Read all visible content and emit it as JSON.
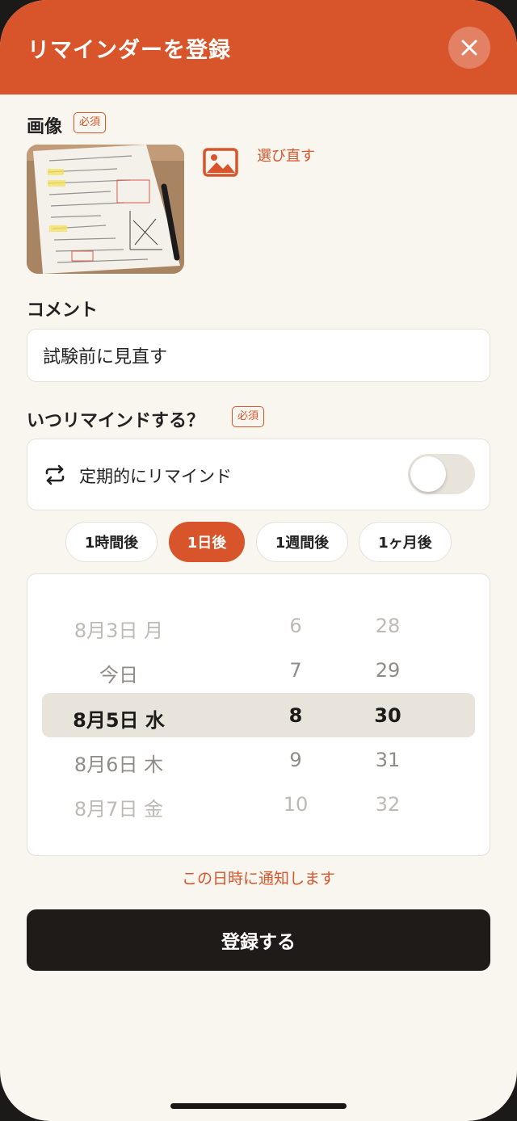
{
  "header": {
    "title": "リマインダーを登録"
  },
  "image_section": {
    "label": "画像",
    "required_badge": "必須",
    "reselect_label": "選び直す"
  },
  "comment_section": {
    "label": "コメント",
    "value": "試験前に見直す"
  },
  "when_section": {
    "label": "いつリマインドする？",
    "required_badge": "必須",
    "recurring_label": "定期的にリマインド",
    "recurring_enabled": false
  },
  "quick_options": {
    "items": [
      "1時間後",
      "1日後",
      "1週間後",
      "1ヶ月後"
    ],
    "selected": "1日後"
  },
  "picker": {
    "dates": [
      "8月3日 月",
      "今日",
      "8月5日 水",
      "8月6日 木",
      "8月7日 金"
    ],
    "hours": [
      "6",
      "7",
      "8",
      "9",
      "10"
    ],
    "minutes": [
      "28",
      "29",
      "30",
      "31",
      "32"
    ],
    "selected_index": 2
  },
  "notice": "この日時に通知します",
  "submit_label": "登録する",
  "colors": {
    "accent": "#d8552c",
    "background": "#f9f5ef",
    "button_dark": "#1e1b18"
  }
}
